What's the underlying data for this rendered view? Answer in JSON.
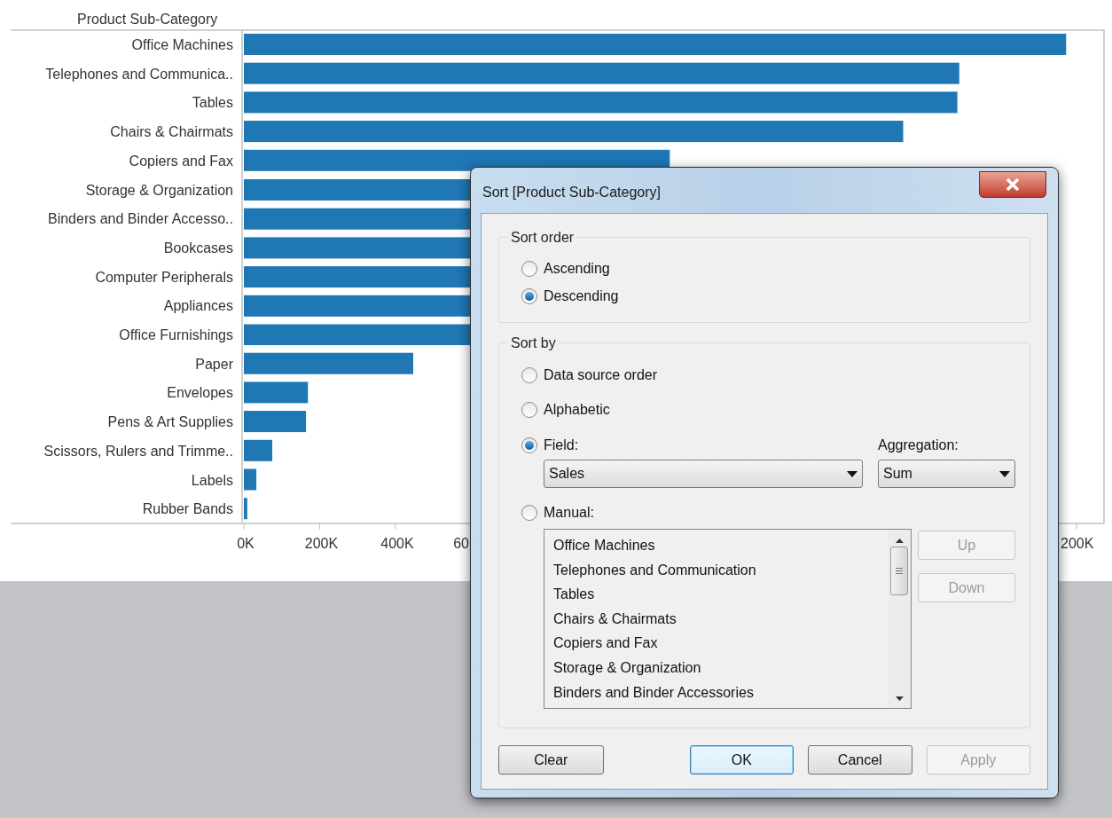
{
  "chart": {
    "chart_data": {
      "type": "bar",
      "orientation": "horizontal",
      "ylabel": "Product Sub-Category",
      "categories": [
        "Office Machines",
        "Telephones and Communica..",
        "Tables",
        "Chairs & Chairmats",
        "Copiers and Fax",
        "Storage & Organization",
        "Binders and Binder Accesso..",
        "Bookcases",
        "Computer Peripherals",
        "Appliances",
        "Office Furnishings",
        "Paper",
        "Envelopes",
        "Pens & Art Supplies",
        "Scissors, Rulers and Trimme..",
        "Labels",
        "Rubber Bands"
      ],
      "values": [
        2170,
        1888,
        1883,
        1740,
        1124,
        null,
        null,
        null,
        null,
        null,
        null,
        447,
        169,
        164,
        75,
        33,
        9
      ],
      "xlim": [
        0,
        2270
      ],
      "xticks": [
        {
          "value": 0,
          "label": "0K"
        },
        {
          "value": 200,
          "label": "200K"
        },
        {
          "value": 400,
          "label": "400K"
        }
      ]
    },
    "cut_tick_labels": [
      "60",
      "200K"
    ]
  },
  "dialog": {
    "title": "Sort [Product Sub-Category]",
    "sort_order": {
      "label": "Sort order",
      "options": [
        {
          "label": "Ascending",
          "selected": false
        },
        {
          "label": "Descending",
          "selected": true
        }
      ]
    },
    "sort_by": {
      "label": "Sort by",
      "options": [
        {
          "label": "Data source order",
          "selected": false
        },
        {
          "label": "Alphabetic",
          "selected": false
        },
        {
          "label": "Field:",
          "selected": true
        },
        {
          "label": "Manual:",
          "selected": false
        }
      ],
      "field": {
        "value": "Sales"
      },
      "aggregation": {
        "label": "Aggregation:",
        "value": "Sum"
      },
      "manual_list": [
        "Office Machines",
        "Telephones and Communication",
        "Tables",
        "Chairs & Chairmats",
        "Copiers and Fax",
        "Storage & Organization",
        "Binders and Binder Accessories"
      ],
      "up": {
        "label": "Up",
        "disabled": true
      },
      "down": {
        "label": "Down",
        "disabled": true
      }
    },
    "buttons": [
      {
        "label": "Clear",
        "disabled": false,
        "focused": false
      },
      {
        "label": "OK",
        "disabled": false,
        "focused": true
      },
      {
        "label": "Cancel",
        "disabled": false,
        "focused": false
      },
      {
        "label": "Apply",
        "disabled": true,
        "focused": false
      }
    ]
  }
}
